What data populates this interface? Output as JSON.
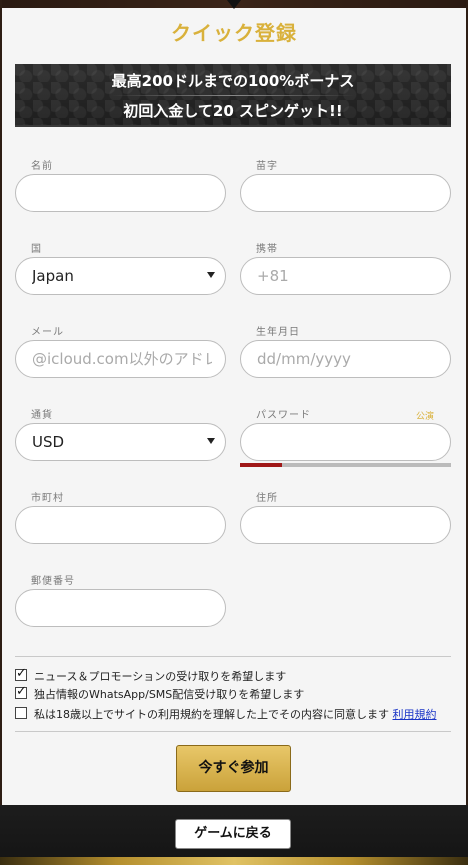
{
  "title": "クイック登録",
  "banner": {
    "line1": "最高200ドルまでの100%ボーナス",
    "line2": "初回入金して20 スピンゲット!!"
  },
  "form": {
    "first_name": {
      "label": "名前",
      "value": ""
    },
    "last_name": {
      "label": "苗字",
      "value": ""
    },
    "country": {
      "label": "国",
      "value": "Japan"
    },
    "mobile": {
      "label": "携帯",
      "placeholder": "+81"
    },
    "email": {
      "label": "メール",
      "placeholder": "@icloud.com以外のアドレ"
    },
    "birthdate": {
      "label": "生年月日",
      "placeholder": "dd/mm/yyyy"
    },
    "currency": {
      "label": "通貨",
      "value": "USD"
    },
    "password": {
      "label": "パスワード",
      "show_label": "公演",
      "value": ""
    },
    "city": {
      "label": "市町村",
      "value": ""
    },
    "address": {
      "label": "住所",
      "value": ""
    },
    "postal_code": {
      "label": "郵便番号",
      "value": ""
    }
  },
  "password_strength": 0.2,
  "checkboxes": [
    {
      "label": "ニュース＆プロモーションの受け取りを希望します",
      "checked": true
    },
    {
      "label": "独占情報のWhatsApp/SMS配信受け取りを希望します",
      "checked": true
    },
    {
      "label": "私は18歳以上でサイトの利用規約を理解した上でその内容に同意します",
      "checked": false,
      "link": "利用規約"
    }
  ],
  "buttons": {
    "join": "今すぐ参加",
    "back": "ゲームに戻る"
  },
  "colors": {
    "accent_gold": "#d9b13b",
    "strength_red": "#a01818",
    "link_blue": "#1a35c7"
  }
}
